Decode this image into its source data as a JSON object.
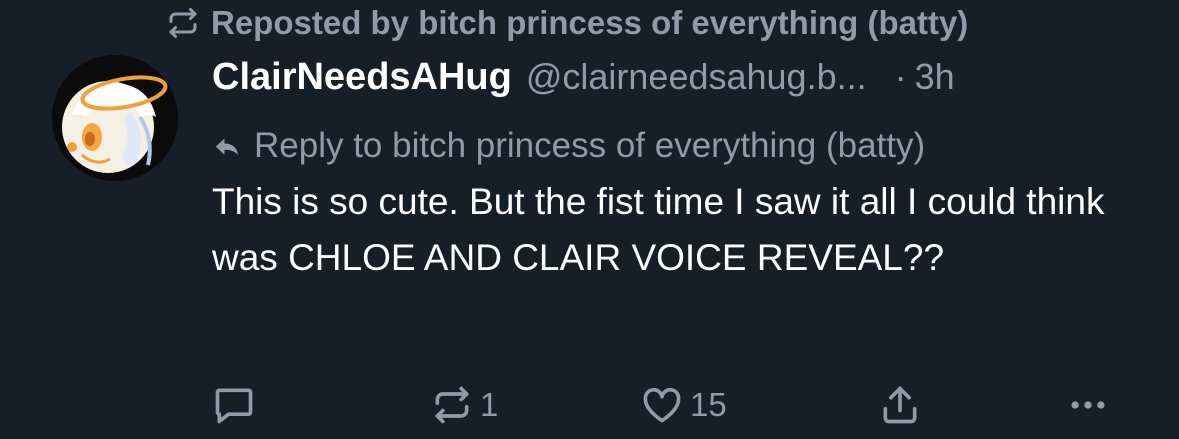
{
  "repost": {
    "icon": "repost-icon",
    "text": "Reposted by bitch princess of everything (batty)"
  },
  "author": {
    "display_name": "ClairNeedsAHug",
    "handle": "@clairneedsahug.b...",
    "separator": "·",
    "time": "3h",
    "avatar": "avatar-image"
  },
  "reply": {
    "icon": "reply-arrow-icon",
    "text": "Reply to bitch princess of everything (batty)"
  },
  "post": {
    "text": "This is so cute. But the fist time I saw it all I could think was CHLOE AND CLAIR VOICE REVEAL??"
  },
  "actions": {
    "reply": {
      "icon": "comment-icon",
      "count": ""
    },
    "repost": {
      "icon": "repost-icon",
      "count": "1"
    },
    "like": {
      "icon": "heart-icon",
      "count": "15"
    },
    "share": {
      "icon": "share-icon"
    },
    "more": {
      "icon": "more-icon"
    }
  },
  "colors": {
    "background": "#161e27",
    "text": "#ffffff",
    "muted": "#8d9bab"
  }
}
